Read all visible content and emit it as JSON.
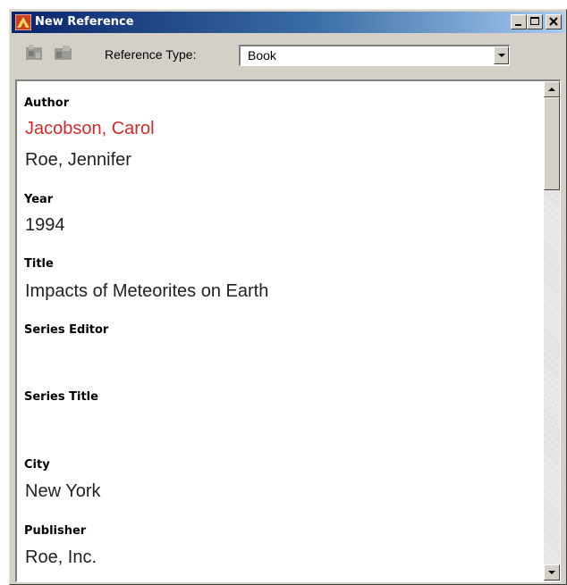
{
  "window": {
    "title": "New Reference",
    "app_icon": "endnote-app-icon",
    "caption_buttons": [
      "minimize-icon",
      "maximize-icon",
      "close-icon"
    ]
  },
  "toolbar": {
    "buttons": [
      "insert-picture-icon",
      "insert-object-icon"
    ],
    "reference_type_label": "Reference Type:",
    "reference_type_value": "Book"
  },
  "fields": [
    {
      "label": "Author",
      "values": [
        "Jacobson, Carol",
        "Roe, Jennifer"
      ]
    },
    {
      "label": "Year",
      "values": [
        "1994"
      ]
    },
    {
      "label": "Title",
      "values": [
        "Impacts of Meteorites on Earth"
      ]
    },
    {
      "label": "Series Editor",
      "values": []
    },
    {
      "label": "Series Title",
      "values": []
    },
    {
      "label": "City",
      "values": [
        "New York"
      ]
    },
    {
      "label": "Publisher",
      "values": [
        "Roe, Inc."
      ]
    }
  ],
  "colors": {
    "title_gradient_start": "#0a246a",
    "title_gradient_end": "#a6caf0",
    "window_face": "#d4d0c8",
    "highlight_author": "#d42828"
  }
}
